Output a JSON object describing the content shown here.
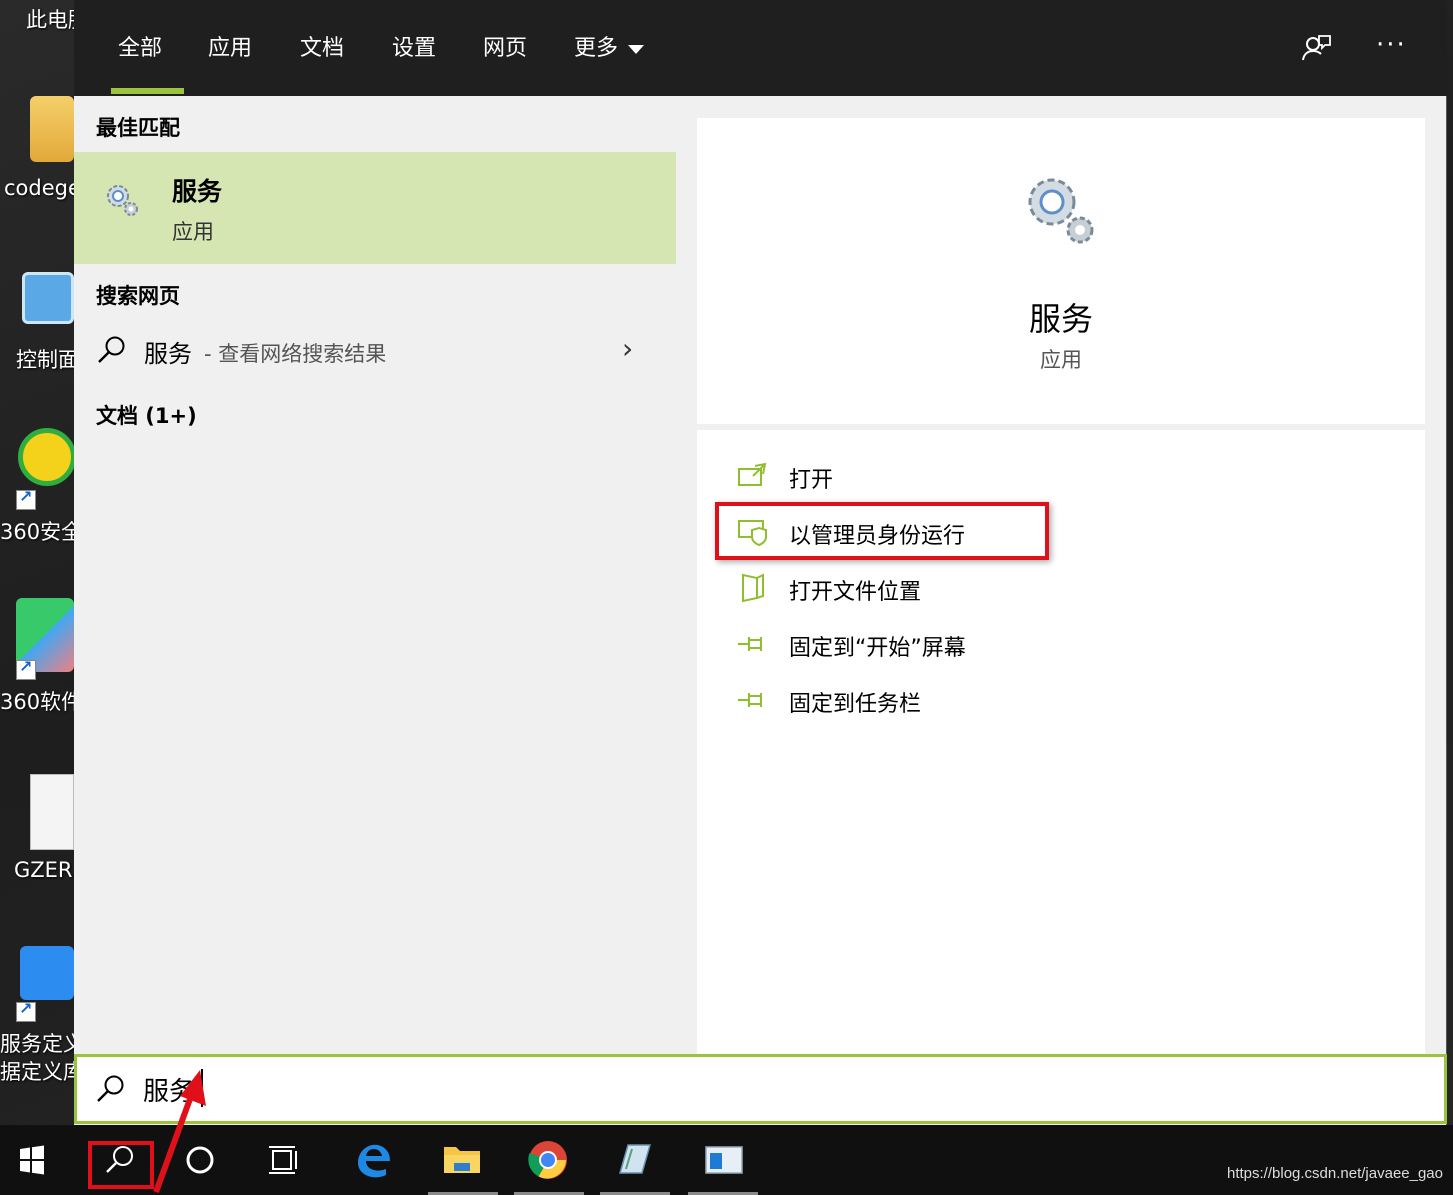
{
  "desktop": {
    "icons": [
      {
        "label": "此电脑"
      },
      {
        "label": "codege"
      },
      {
        "label": "控制面"
      },
      {
        "label": "360安全"
      },
      {
        "label": "360软件"
      },
      {
        "label": "GZER."
      },
      {
        "label": "服务定义"
      },
      {
        "label": "据定义库"
      }
    ]
  },
  "search_panel": {
    "tabs": [
      {
        "label": "全部",
        "active": true
      },
      {
        "label": "应用"
      },
      {
        "label": "文档"
      },
      {
        "label": "设置"
      },
      {
        "label": "网页"
      },
      {
        "label": "更多"
      }
    ],
    "feedback_icon": "feedback-icon",
    "more_options": "···",
    "best_match": {
      "heading": "最佳匹配",
      "title": "服务",
      "subtitle": "应用",
      "icon": "gears-icon"
    },
    "web_search": {
      "heading": "搜索网页",
      "query": "服务",
      "hint": "- 查看网络搜索结果"
    },
    "documents": {
      "heading": "文档 (1+)"
    },
    "preview": {
      "title": "服务",
      "subtitle": "应用",
      "icon": "gears-icon"
    },
    "actions": [
      {
        "label": "打开",
        "icon": "open-icon"
      },
      {
        "label": "以管理员身份运行",
        "icon": "shield-admin-icon",
        "highlighted": true
      },
      {
        "label": "打开文件位置",
        "icon": "folder-location-icon"
      },
      {
        "label": "固定到“开始”屏幕",
        "icon": "pin-icon"
      },
      {
        "label": "固定到任务栏",
        "icon": "pin-icon"
      }
    ],
    "search_box": {
      "value": "服务"
    }
  },
  "taskbar": {
    "items": [
      "windows-start",
      "search",
      "cortana",
      "task-view",
      "edge",
      "file-explorer",
      "chrome",
      "notepad-app",
      "window-app"
    ],
    "watermark": "https://blog.csdn.net/javaee_gao"
  },
  "colors": {
    "accent": "#9bc33e",
    "best_match_bg": "#d6e6b3",
    "annotation_red": "#e0101a"
  }
}
